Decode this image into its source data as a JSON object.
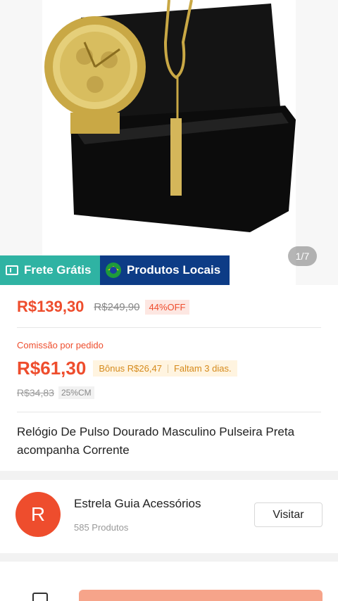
{
  "gallery": {
    "counter": "1/7"
  },
  "badges": {
    "frete": "Frete Grátis",
    "local": "Produtos Locais"
  },
  "pricing": {
    "price": "R$139,30",
    "old_price": "R$249,90",
    "discount": "44%OFF"
  },
  "commission": {
    "label": "Comissão por pedido",
    "value": "R$61,30",
    "bonus": "Bônus R$26,47",
    "deadline": "Faltam 3 dias.",
    "old_value": "R$34,83",
    "rate": "25%CM"
  },
  "product": {
    "title": "Relógio De Pulso Dourado Masculino Pulseira Preta acompanha Corrente"
  },
  "shop": {
    "avatar_letter": "R",
    "name": "Estrela Guia Acessórios",
    "product_count": "585 Produtos",
    "visit_label": "Visitar"
  },
  "colors": {
    "accent": "#ee4d2d",
    "frete_badge": "#2fb3a3",
    "local_badge": "#0d3c86",
    "bonus_text": "#d58a1c"
  },
  "icons": {
    "frete": "ticket-icon",
    "local": "brazil-flag-icon"
  }
}
